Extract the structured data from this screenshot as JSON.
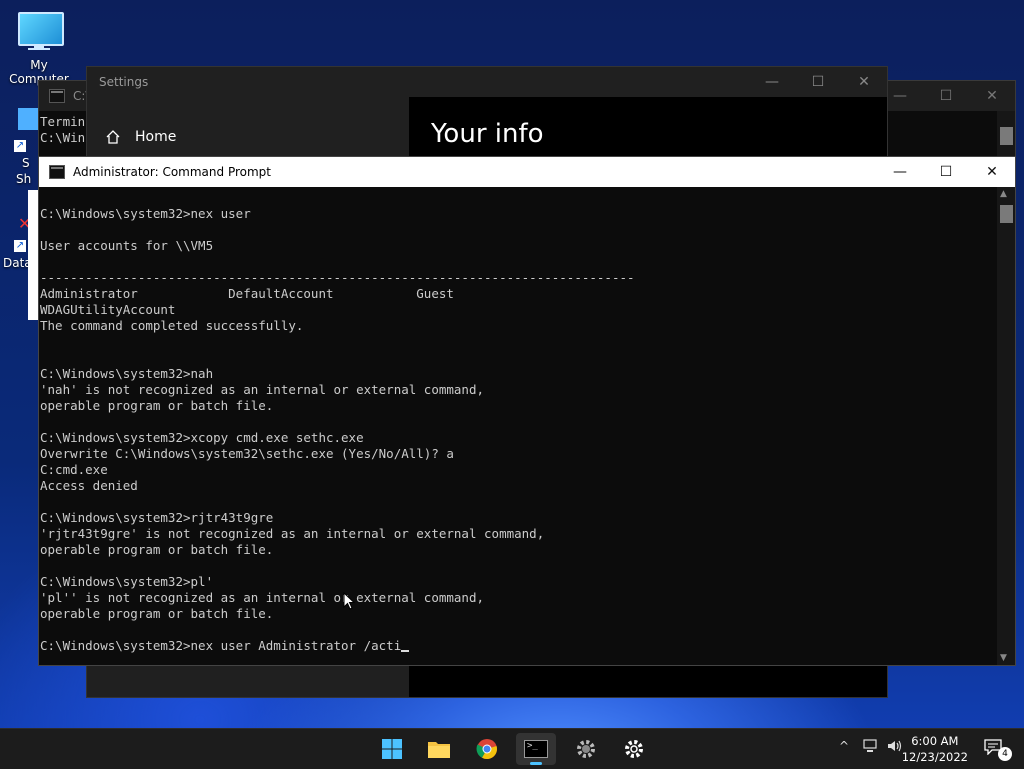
{
  "desktop": {
    "icons": [
      {
        "label": "My Computer"
      },
      {
        "label": "S"
      },
      {
        "label": "Sh"
      },
      {
        "label": "Data"
      }
    ]
  },
  "back_cmd": {
    "title": "C:\\",
    "lines": [
      "Termin",
      "",
      "C:\\Win"
    ]
  },
  "settings": {
    "title": "Settings",
    "nav_home": "Home",
    "heading": "Your info"
  },
  "main_cmd": {
    "title": "Administrator: Command Prompt",
    "lines": [
      "",
      "C:\\Windows\\system32>nex user",
      "",
      "User accounts for \\\\VM5",
      "",
      "-------------------------------------------------------------------------------",
      "Administrator            DefaultAccount           Guest",
      "WDAGUtilityAccount",
      "The command completed successfully.",
      "",
      "",
      "C:\\Windows\\system32>nah",
      "'nah' is not recognized as an internal or external command,",
      "operable program or batch file.",
      "",
      "C:\\Windows\\system32>xcopy cmd.exe sethc.exe",
      "Overwrite C:\\Windows\\system32\\sethc.exe (Yes/No/All)? a",
      "C:cmd.exe",
      "Access denied",
      "",
      "C:\\Windows\\system32>rjtr43t9gre",
      "'rjtr43t9gre' is not recognized as an internal or external command,",
      "operable program or batch file.",
      "",
      "C:\\Windows\\system32>pl'",
      "'pl'' is not recognized as an internal or external command,",
      "operable program or batch file.",
      "",
      "C:\\Windows\\system32>nex user Administrator /acti"
    ]
  },
  "window_controls": {
    "minimize": "—",
    "maximize": "☐",
    "close": "✕"
  },
  "taskbar": {
    "time": "6:00 AM",
    "date": "12/23/2022",
    "notification_count": "4",
    "tray_chevron": "^"
  }
}
